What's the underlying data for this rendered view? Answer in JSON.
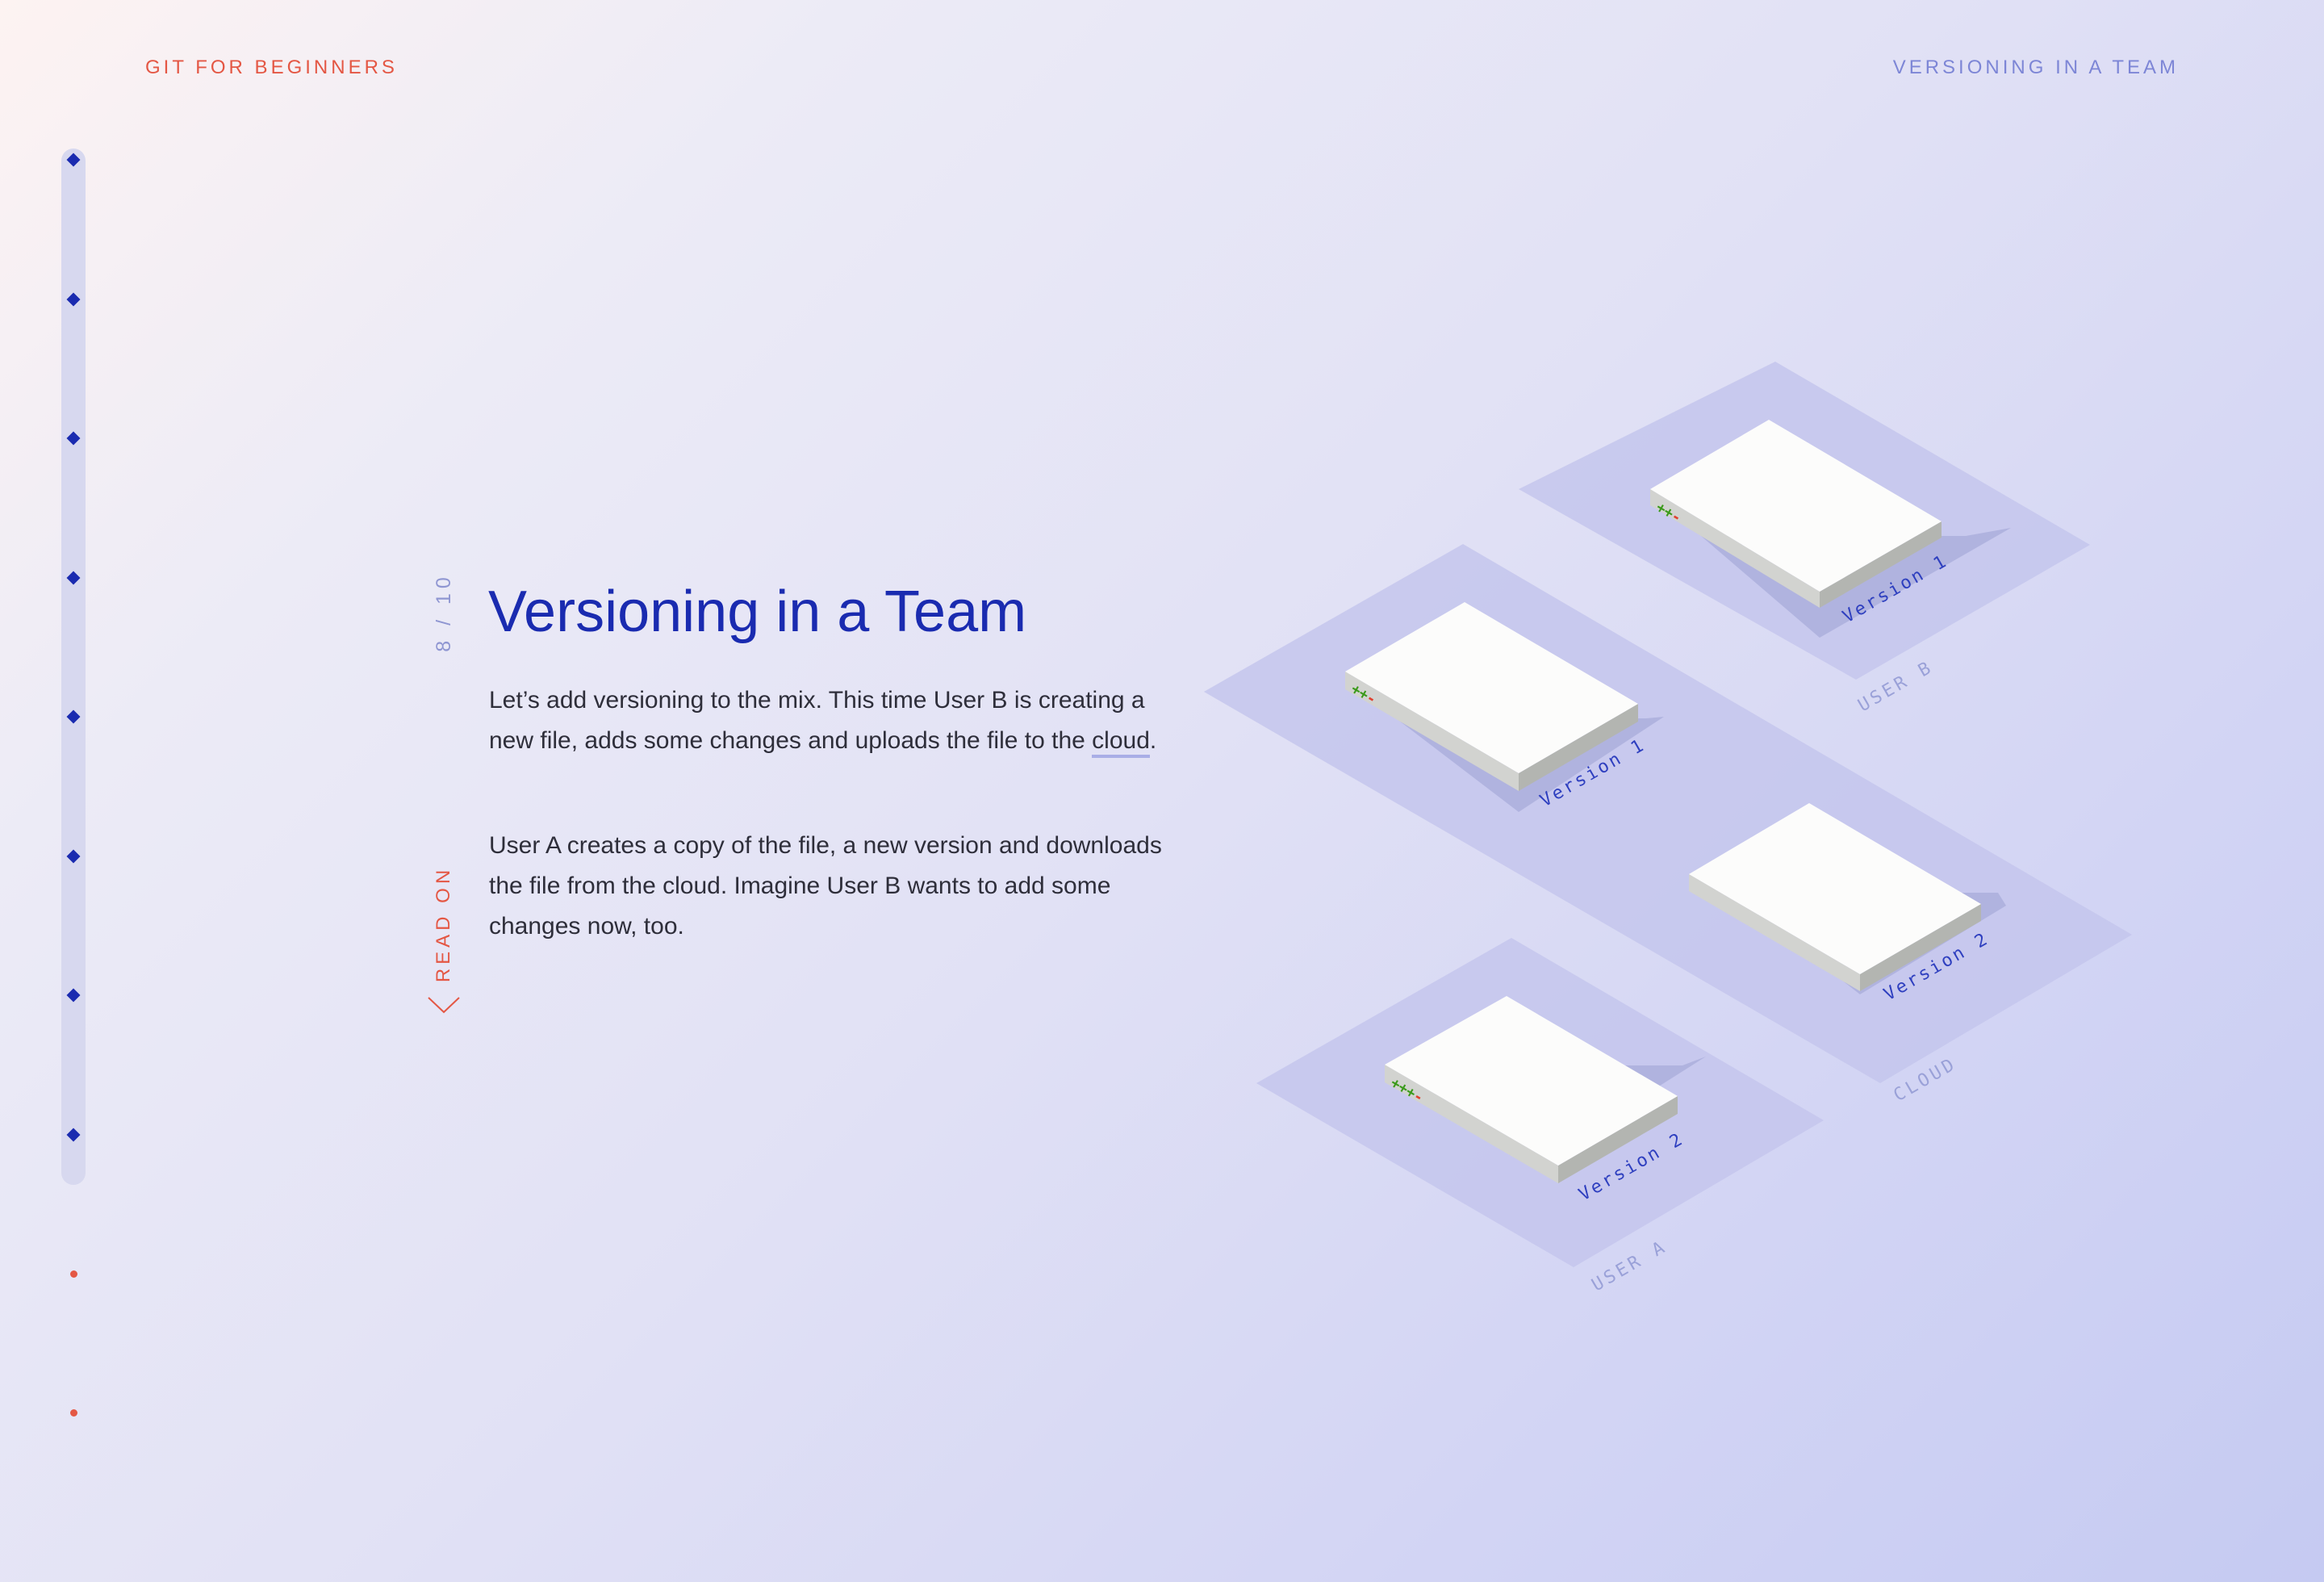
{
  "header": {
    "site_title": "GIT FOR BEGINNERS",
    "section_title": "VERSIONING IN A TEAM"
  },
  "progress": {
    "completed_count": 8,
    "upcoming_count": 2,
    "counter": "8 / 10"
  },
  "read_on": "READ ON",
  "main": {
    "heading": "Versioning in a Team",
    "paragraph1_text": "Let’s add versioning to the mix. This time User B is creating a new file, adds some changes and uploads the file to the ",
    "paragraph1_link": "cloud",
    "paragraph1_end": ".",
    "paragraph2": "User A creates a copy of the file, a new version and downloads the file from the cloud. Imagine User B wants to add some changes now, too."
  },
  "illustration": {
    "zones": {
      "user_b": "USER B",
      "cloud": "CLOUD",
      "user_a": "USER A"
    },
    "files": {
      "user_b_file": {
        "label": "Version 1",
        "marks": "++-"
      },
      "cloud_file_1": {
        "label": "Version 1",
        "marks": "++-"
      },
      "cloud_file_2": {
        "label": "Version 2",
        "marks": ""
      },
      "user_a_file": {
        "label": "Version 2",
        "marks": "+++-"
      }
    }
  },
  "colors": {
    "accent_red": "#e45744",
    "primary_blue": "#1a2bb0",
    "muted_blue": "#7d86d6",
    "plus_mark": "#3a9a1a",
    "minus_mark": "#e0402e"
  }
}
